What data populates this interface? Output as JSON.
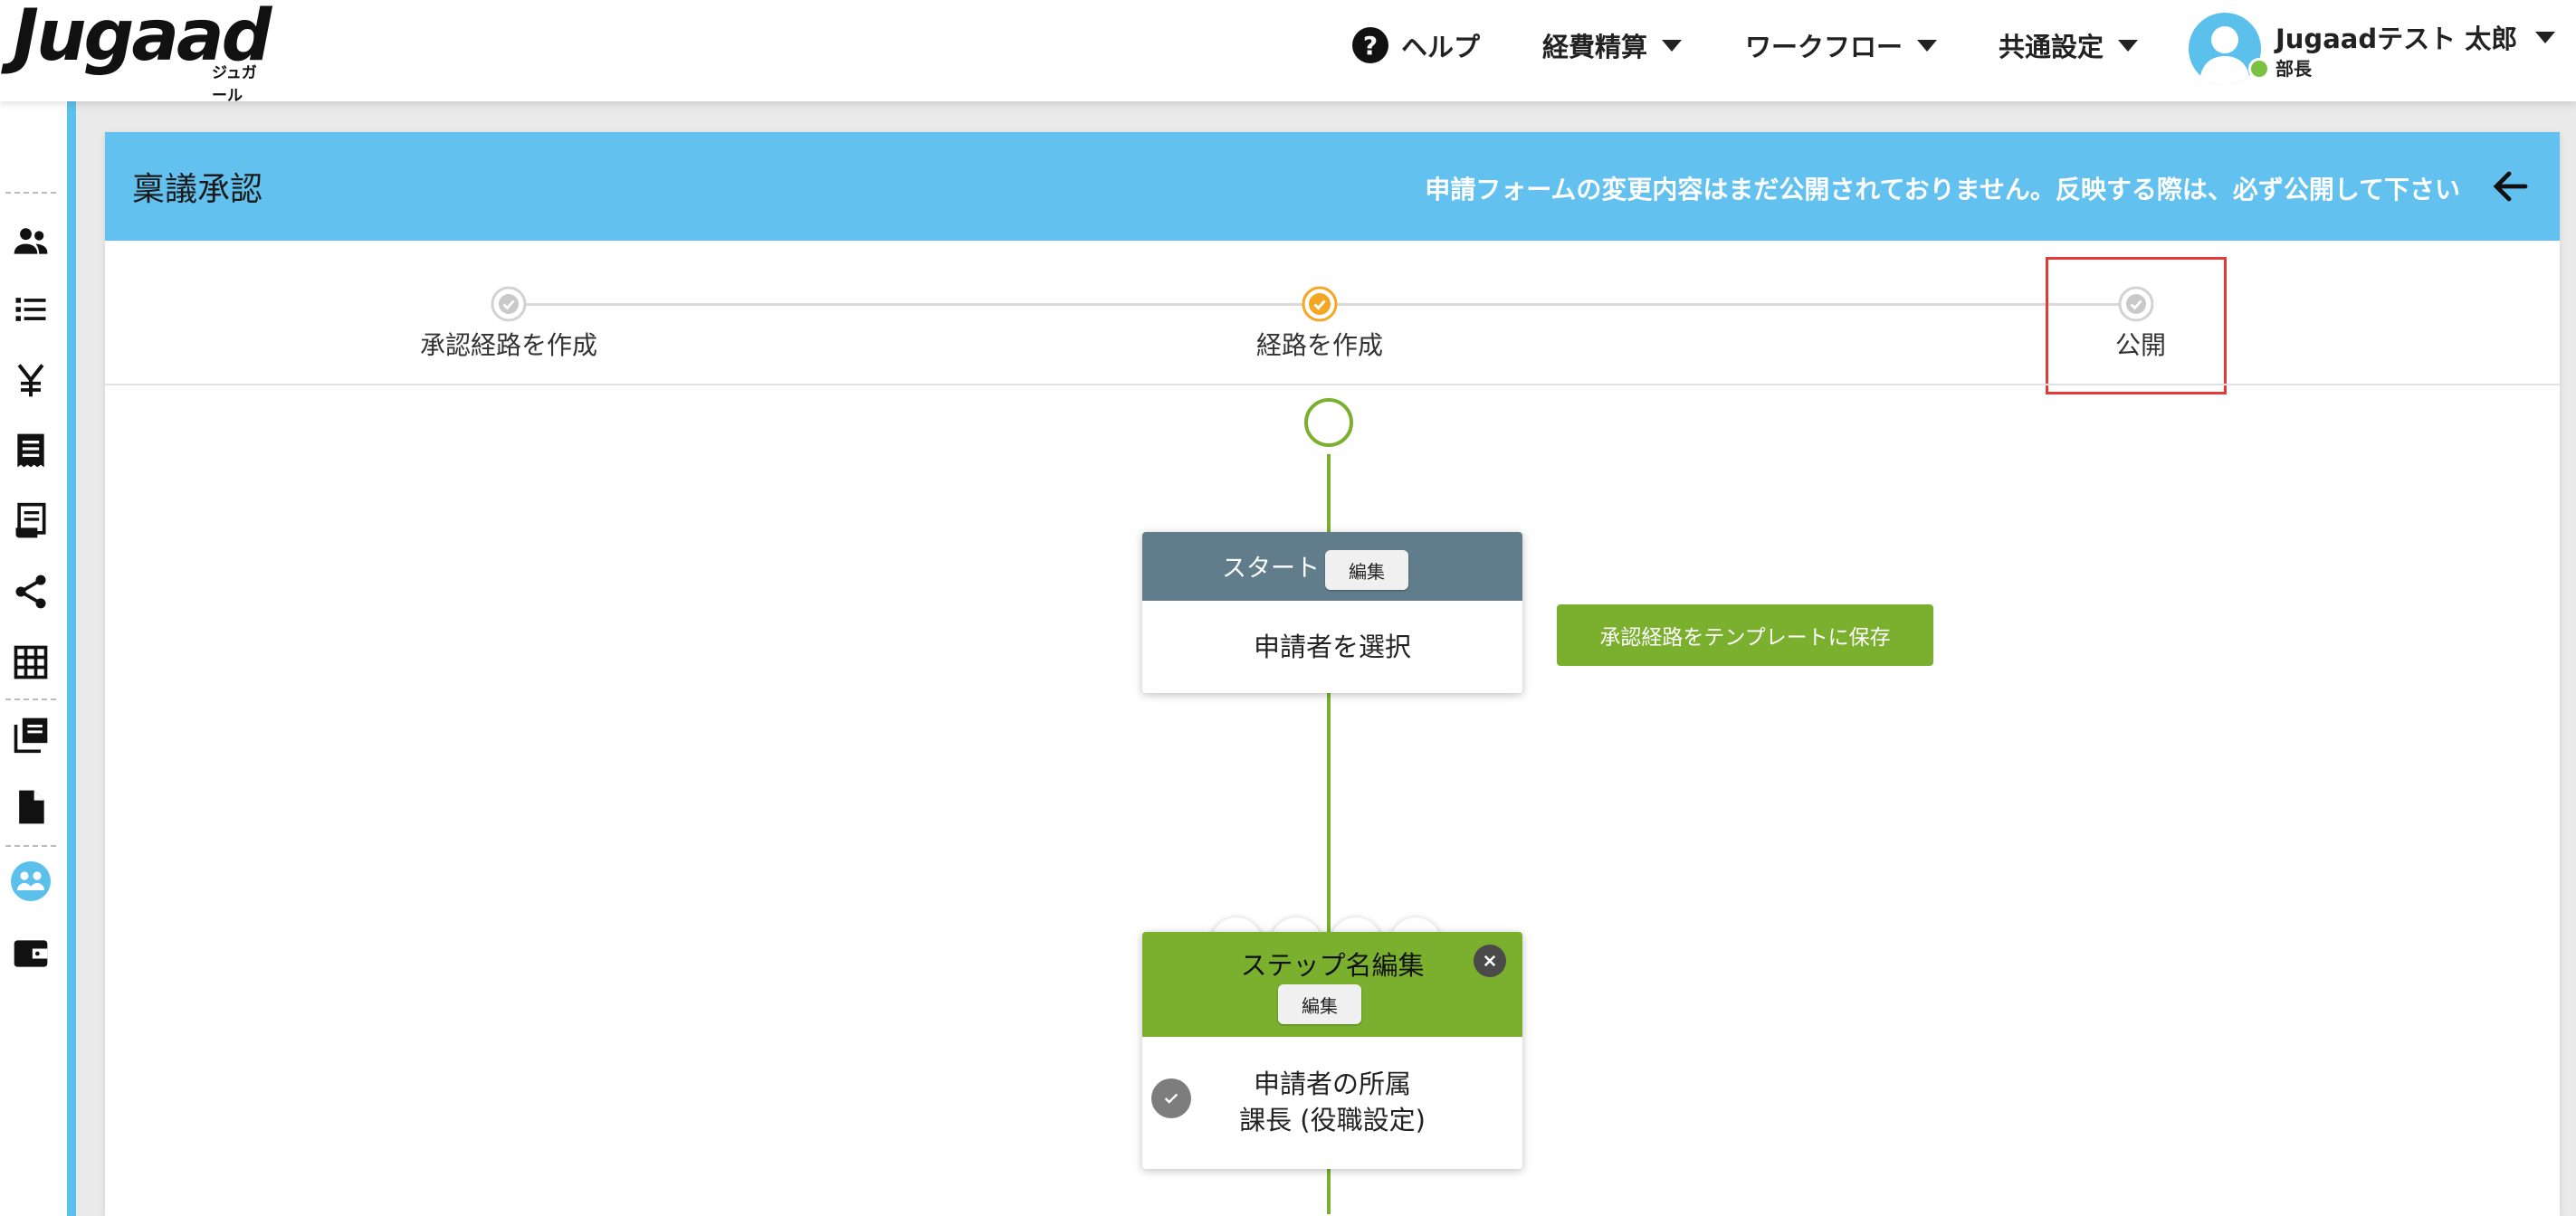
{
  "header": {
    "logo": "Jugaad",
    "logo_sub": "ジュガール",
    "help_label": "ヘルプ",
    "nav": {
      "expense": "経費精算",
      "workflow": "ワークフロー",
      "common": "共通設定"
    },
    "user_name": "Jugaadテスト 太郎",
    "user_role": "部長"
  },
  "colors": {
    "header_bar": "#62c1ee",
    "accent_green": "#7ab02e",
    "start_head": "#617d8c",
    "active_step": "#f5a623",
    "highlight": "#e53935"
  },
  "card": {
    "title": "稟議承認",
    "notice": "申請フォームの変更内容はまだ公開されておりません。反映する際は、必ず公開して下さい"
  },
  "stepper": {
    "steps": [
      {
        "label": "承認経路を作成",
        "state": "done"
      },
      {
        "label": "経路を作成",
        "state": "active"
      },
      {
        "label": "公開",
        "state": "pending"
      }
    ]
  },
  "flow": {
    "start_node": {
      "title": "スタート",
      "edit": "編集",
      "body": "申請者を選択"
    },
    "save_template": "承認経路をテンプレートに保存",
    "step_node": {
      "title": "ステップ名編集",
      "edit": "編集",
      "body_line1": "申請者の所属",
      "body_line2": "課長 (役職設定)"
    }
  }
}
